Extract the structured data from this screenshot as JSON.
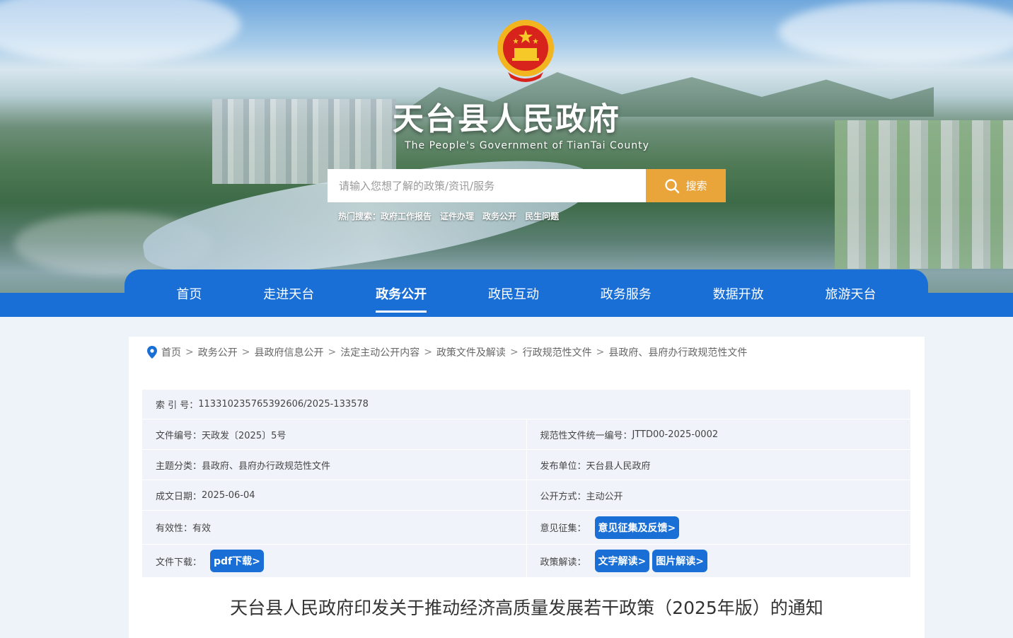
{
  "header": {
    "title": "天台县人民政府",
    "subtitle": "The People's Government of TianTai County",
    "search": {
      "placeholder": "请输入您想了解的政策/资讯/服务",
      "button_label": "搜索"
    },
    "hot_search": {
      "label": "热门搜索：",
      "items": [
        "政府工作报告",
        "证件办理",
        "政务公开",
        "民生问题"
      ]
    }
  },
  "nav": {
    "items": [
      {
        "label": "首页"
      },
      {
        "label": "走进天台"
      },
      {
        "label": "政务公开"
      },
      {
        "label": "政民互动"
      },
      {
        "label": "政务服务"
      },
      {
        "label": "数据开放"
      },
      {
        "label": "旅游天台"
      }
    ],
    "active": "政务公开"
  },
  "breadcrumb": {
    "items": [
      "首页",
      "政务公开",
      "县政府信息公开",
      "法定主动公开内容",
      "政策文件及解读",
      "行政规范性文件",
      "县政府、县府办行政规范性文件"
    ],
    "separator": ">"
  },
  "meta": {
    "index_label": "索 引 号：",
    "index_value": "113310235765392606/2025-133578",
    "doc_no_label": "文件编号：",
    "doc_no_value": "天政发〔2025〕5号",
    "unified_no_label": "规范性文件统一编号：",
    "unified_no_value": "JTTD00-2025-0002",
    "topic_label": "主题分类：",
    "topic_value": "县政府、县府办行政规范性文件",
    "issuer_label": "发布单位：",
    "issuer_value": "天台县人民政府",
    "date_label": "成文日期：",
    "date_value": "2025-06-04",
    "open_label": "公开方式：",
    "open_value": "主动公开",
    "validity_label": "有效性：",
    "validity_value": "有效",
    "feedback_label": "意见征集：",
    "feedback_button": "意见征集及反馈>",
    "download_label": "文件下载：",
    "download_button": "pdf下载>",
    "interpret_label": "政策解读：",
    "interpret_text_button": "文字解读>",
    "interpret_image_button": "图片解读>"
  },
  "document": {
    "title": "天台县人民政府印发关于推动经济高质量发展若干政策（2025年版）的通知"
  },
  "colors": {
    "nav_blue": "#1a6fd6",
    "search_orange": "#e9a43a",
    "meta_bg": "#f0f4fa"
  }
}
